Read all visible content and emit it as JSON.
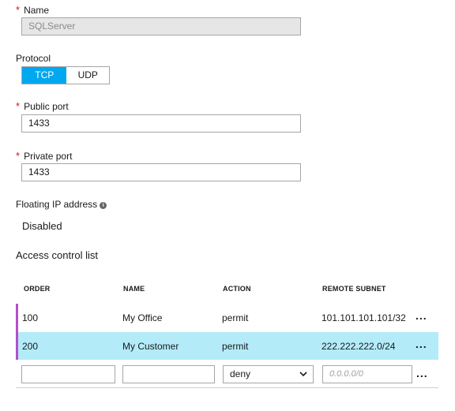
{
  "name": {
    "label": "Name",
    "value": "SQLServer"
  },
  "protocol": {
    "label": "Protocol",
    "options": [
      "TCP",
      "UDP"
    ],
    "selected": "TCP"
  },
  "public_port": {
    "label": "Public port",
    "value": "1433"
  },
  "private_port": {
    "label": "Private port",
    "value": "1433"
  },
  "floating_ip": {
    "label": "Floating IP address",
    "value": "Disabled"
  },
  "acl": {
    "title": "Access control list",
    "columns": [
      "ORDER",
      "NAME",
      "ACTION",
      "REMOTE SUBNET"
    ],
    "rows": [
      {
        "order": "100",
        "name": "My Office",
        "action": "permit",
        "subnet": "101.101.101.101/32",
        "more": "...",
        "accent": "#b54fc8"
      },
      {
        "order": "200",
        "name": "My Customer",
        "action": "permit",
        "subnet": "222.222.222.0/24",
        "more": "...",
        "accent": "#b54fc8",
        "highlight": "#b3ebf9"
      }
    ],
    "new_row": {
      "action": "deny",
      "subnet_placeholder": "0.0.0.0/0",
      "more": "..."
    }
  },
  "colors": {
    "accent": "#00a8f0",
    "required": "#e00b1c",
    "selected_row": "#b3ebf9",
    "row_marker": "#b54fc8"
  }
}
